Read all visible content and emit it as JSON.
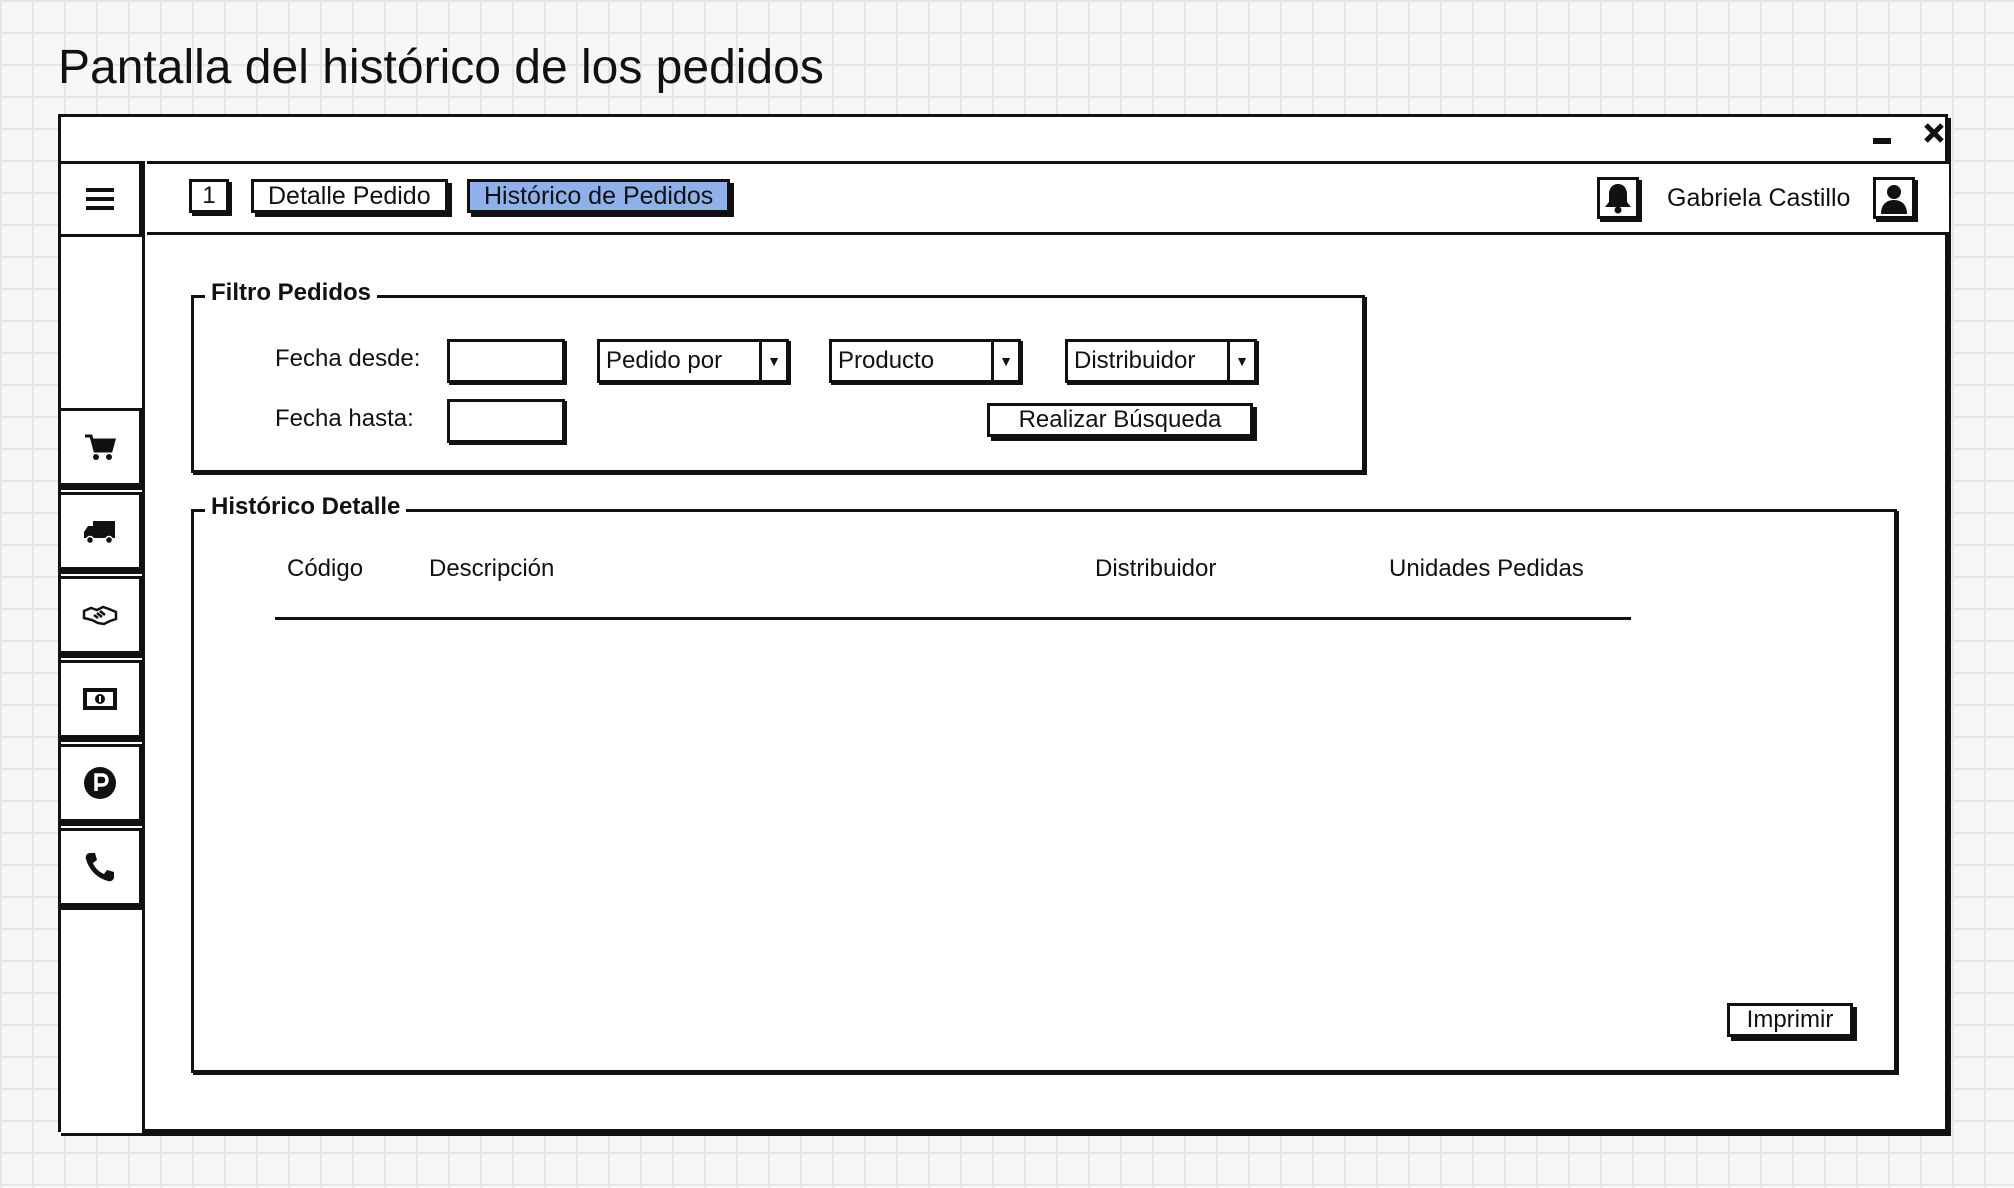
{
  "page_title": "Pantalla del histórico de los pedidos",
  "window": {
    "minimize_icon": "minimize-icon",
    "close_icon": "close-icon"
  },
  "topbar": {
    "menu_icon": "hamburger-menu-icon",
    "badge": "1",
    "tabs": [
      {
        "label": "Detalle Pedido",
        "active": false
      },
      {
        "label": "Histórico de Pedidos",
        "active": true
      }
    ],
    "notification_icon": "bell-icon",
    "user_name": "Gabriela Castillo",
    "avatar_icon": "user-icon",
    "active_tab_color": "#8fb1ea"
  },
  "sidebar": {
    "items": [
      {
        "icon": "cart-icon"
      },
      {
        "icon": "truck-icon"
      },
      {
        "icon": "handshake-icon"
      },
      {
        "icon": "money-icon"
      },
      {
        "icon": "parking-icon"
      },
      {
        "icon": "phone-icon"
      }
    ]
  },
  "filter": {
    "legend": "Filtro Pedidos",
    "fecha_desde_label": "Fecha desde:",
    "fecha_hasta_label": "Fecha hasta:",
    "fecha_desde_value": "",
    "fecha_hasta_value": "",
    "pedido_por": "Pedido por",
    "producto": "Producto",
    "distribuidor": "Distribuidor",
    "search_button": "Realizar Búsqueda"
  },
  "history": {
    "legend": "Histórico Detalle",
    "columns": [
      "Código",
      "Descripción",
      "Distribuidor",
      "Unidades Pedidas"
    ],
    "rows": [],
    "print_button": "Imprimir"
  }
}
